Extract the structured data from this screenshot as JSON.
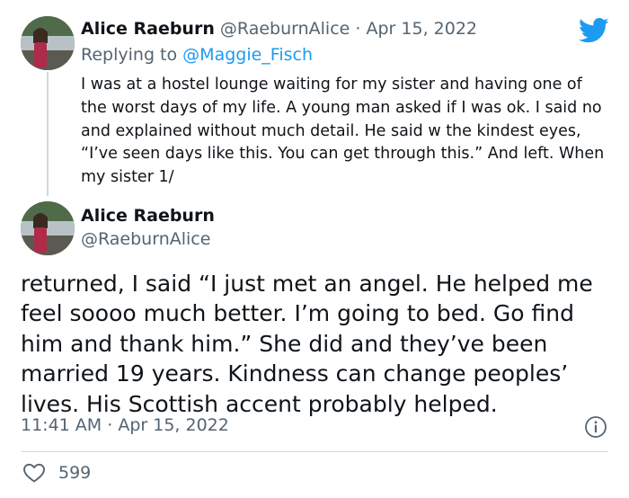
{
  "tweet1": {
    "name": "Alice Raeburn",
    "handle": "@RaeburnAlice",
    "separator": "·",
    "date": "Apr 15, 2022",
    "reply_prefix": "Replying to",
    "reply_handle": "@Maggie_Fisch",
    "text": "I was at a hostel lounge waiting for my sister and having one of the worst days of my life. A young man asked if I was ok. I said no and explained without much detail. He said w the kindest eyes, “I’ve seen days like this. You can get through this.” And left. When my sister 1/"
  },
  "tweet2": {
    "name": "Alice Raeburn",
    "handle": "@RaeburnAlice",
    "text": "returned, I said “I just met an angel. He helped me feel soooo much better. I’m going to bed. Go find him and thank him.” She did and they’ve been married 19 years. Kindness can change peoples’ lives. His Scottish accent probably helped.",
    "time": "11:41 AM",
    "separator": "·",
    "date": "Apr 15, 2022",
    "like_count": "599"
  },
  "icons": {
    "logo": "twitter-bird-icon",
    "info": "info-icon",
    "like": "heart-icon"
  },
  "colors": {
    "brand": "#1d9bf0",
    "text": "#0f1419",
    "muted": "#536471",
    "divider": "#cfd9de"
  }
}
